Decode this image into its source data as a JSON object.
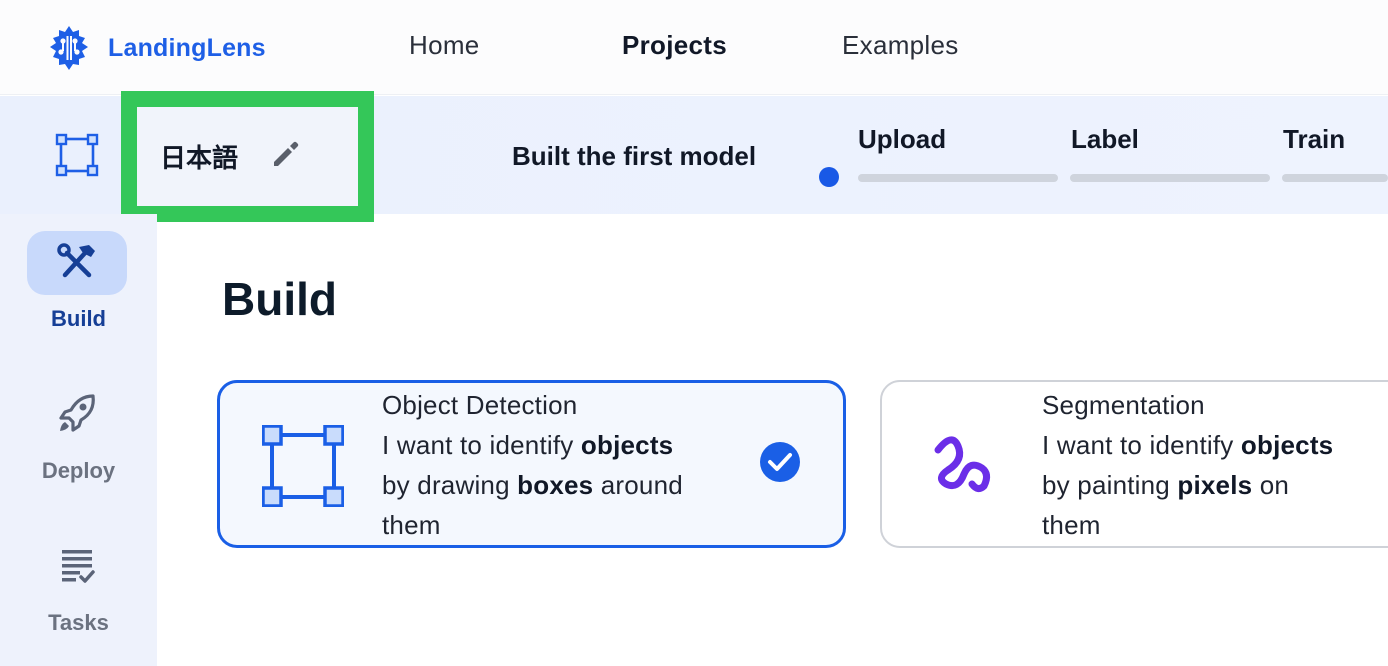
{
  "app": {
    "brand": "LandingLens",
    "accent_color": "#1e5fe6",
    "nav": [
      {
        "label": "Home",
        "active": false
      },
      {
        "label": "Projects",
        "active": true
      },
      {
        "label": "Examples",
        "active": false
      }
    ]
  },
  "project": {
    "name": "日本語",
    "milestone": "Built the first model",
    "steps": [
      {
        "label": "Upload",
        "progress": 0
      },
      {
        "label": "Label",
        "progress": 0
      },
      {
        "label": "Train",
        "progress": 0
      }
    ],
    "highlight_color": "#34c759"
  },
  "sidebar": {
    "items": [
      {
        "label": "Build",
        "icon": "tools-icon",
        "active": true
      },
      {
        "label": "Deploy",
        "icon": "rocket-icon",
        "active": false
      },
      {
        "label": "Tasks",
        "icon": "task-list-icon",
        "active": false
      }
    ]
  },
  "main": {
    "title": "Build",
    "cards": [
      {
        "title": "Object Detection",
        "line1_pre": "I want to identify ",
        "line1_bold": "objects",
        "line2_pre": "by drawing ",
        "line2_bold": "boxes",
        "line2_post": " around",
        "line3": "them",
        "icon": "bounding-box-icon",
        "selected": true
      },
      {
        "title": "Segmentation",
        "line1_pre": "I want to identify ",
        "line1_bold": "objects",
        "line2_pre": "by painting ",
        "line2_bold": "pixels",
        "line2_post": " on",
        "line3": "them",
        "icon": "squiggle-brush-icon",
        "selected": false
      }
    ]
  }
}
